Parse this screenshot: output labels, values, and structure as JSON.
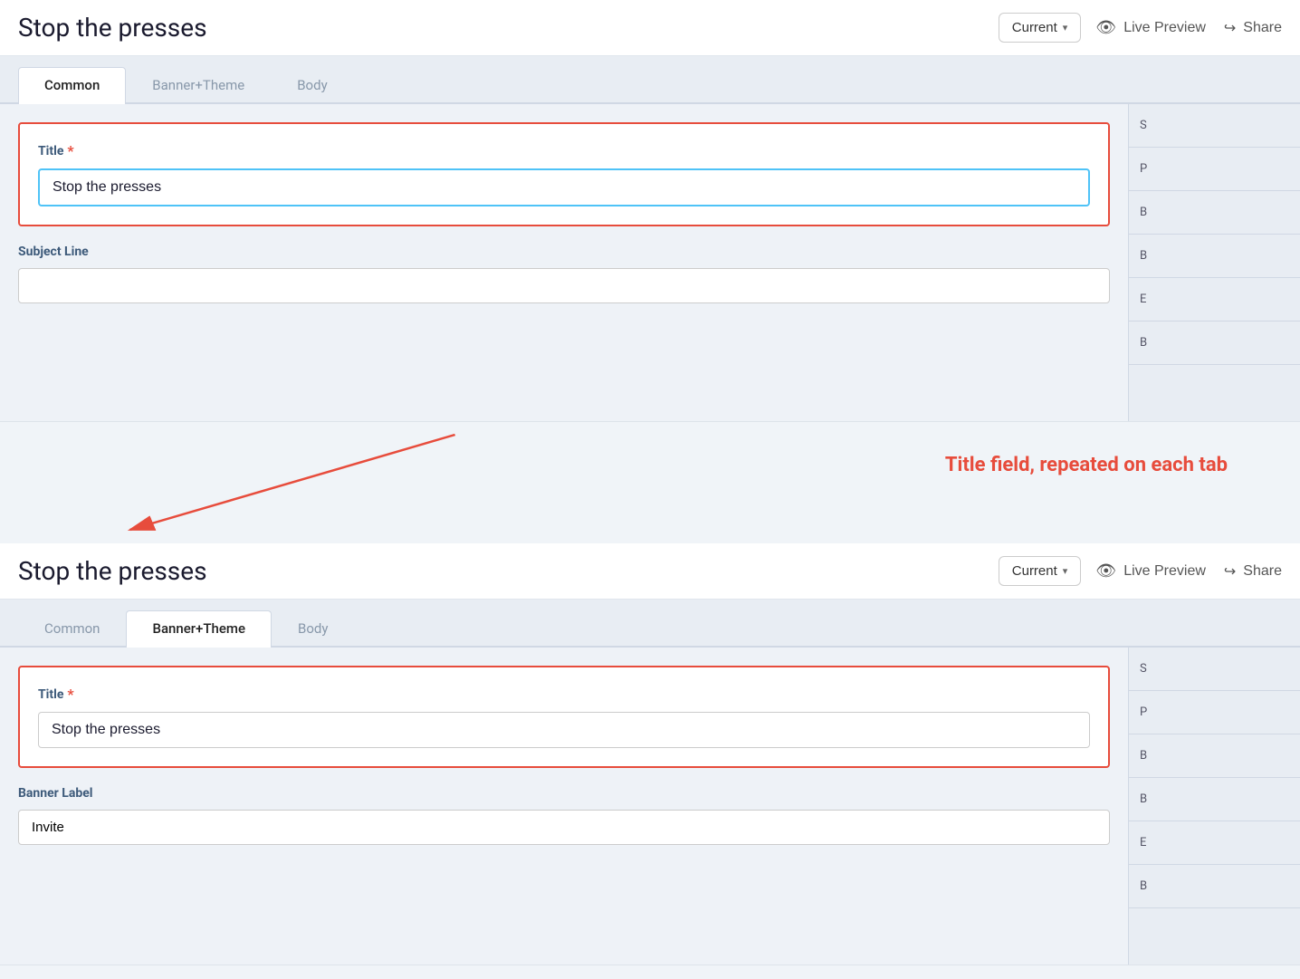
{
  "panels": [
    {
      "id": "panel-top",
      "header": {
        "title": "Stop the presses",
        "version_label": "Current",
        "live_preview_label": "Live Preview",
        "share_label": "Share"
      },
      "tabs": [
        {
          "id": "common",
          "label": "Common",
          "active": true
        },
        {
          "id": "banner-theme",
          "label": "Banner+Theme",
          "active": false
        },
        {
          "id": "body",
          "label": "Body",
          "active": false
        }
      ],
      "fields": {
        "title": {
          "label": "Title",
          "required": true,
          "value": "Stop the presses",
          "focused": true
        },
        "subject_line": {
          "label": "Subject Line",
          "value": "",
          "placeholder": ""
        }
      }
    },
    {
      "id": "panel-bottom",
      "header": {
        "title": "Stop the presses",
        "version_label": "Current",
        "live_preview_label": "Live Preview",
        "share_label": "Share"
      },
      "tabs": [
        {
          "id": "common",
          "label": "Common",
          "active": false
        },
        {
          "id": "banner-theme",
          "label": "Banner+Theme",
          "active": true
        },
        {
          "id": "body",
          "label": "Body",
          "active": false
        }
      ],
      "fields": {
        "title": {
          "label": "Title",
          "required": true,
          "value": "Stop the presses",
          "focused": false
        },
        "banner_label": {
          "label": "Banner Label",
          "value": "Invite"
        }
      }
    }
  ],
  "annotation": {
    "text": "Title field, repeated on each tab",
    "arrow_color": "#e74c3c"
  },
  "sidebar": {
    "items": [
      "S",
      "P",
      "B",
      "B",
      "E",
      "B"
    ]
  }
}
